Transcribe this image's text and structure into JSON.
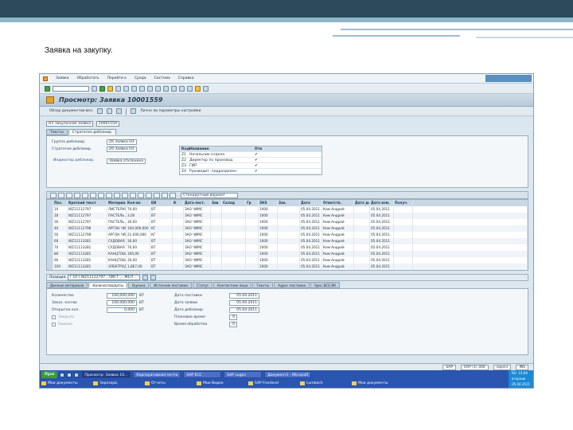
{
  "slide": {
    "title": "Заявка на закупку."
  },
  "menu": [
    "Заявка",
    "Обработать",
    "Перейти к",
    "Среда",
    "Система",
    "Справка"
  ],
  "window": {
    "title": "Просмотр: Заявка 10001559"
  },
  "app_toolbar": [
    "Обзор документов вкл.",
    "Лично ли параметры настройки"
  ],
  "doc_type": {
    "value": "НЗ Закупочная заявка",
    "doc_number": "10001559"
  },
  "header_tabs": [
    "Тексты",
    "Стратегия деблокир."
  ],
  "header": {
    "group_label": "Группа деблокир.",
    "group_value": "Z6 Заявка НЗ",
    "strategy_label": "Стратегия деблокир.",
    "strategy_value": "Z6 Заявка НЗ",
    "indicator_label": "Индикатор деблокир.",
    "indicator_value": "Заявка отклонена",
    "status_columns": [
      "Код",
      "Название",
      "Отк"
    ],
    "status_rows": [
      {
        "code": "Z1",
        "name": "Начальник отдела"
      },
      {
        "code": "Z2",
        "name": "Директор по производ."
      },
      {
        "code": "Z3",
        "name": "ГИП"
      },
      {
        "code": "Z4",
        "name": "Руководит. подразделен."
      }
    ]
  },
  "item_toolbar": {
    "select_label": "Стандартный вариант"
  },
  "grid": {
    "columns": [
      "",
      "Поз.",
      "Краткий текст",
      "Материал",
      "Кол-во",
      "ЕИ",
      "К",
      "Дата пост.",
      "Зав",
      "Склад",
      "Гр",
      "ЗНЗ",
      "Зак.",
      "Дата",
      "Ответств.",
      "Дата дебл.",
      "Дата изм.",
      "Получ.",
      ""
    ],
    "rows": [
      {
        "pos": "10",
        "text": "WZ11112797",
        "mat": "ЛИСТЕЛКОВОЛЬ_РОЗОВЫЙ",
        "qty": "70,00",
        "unit": "ВТ",
        "date1": "ЗАО ЧИМС",
        "werk": "1000",
        "lager": "05.04.2011",
        "ekgrp": "Ким Андрей",
        "due": "05.04.2011"
      },
      {
        "pos": "20",
        "text": "WZ11112797",
        "mat": "ПАСТЕЛЬ ДЛЯ ДЛ. УГЛОВАЯ",
        "qty": "3,00",
        "unit": "ВТ",
        "date1": "ЗАО ЧИМС",
        "werk": "1000",
        "lager": "05.04.2011",
        "ekgrp": "Ким Андрей",
        "due": "05.04.2011"
      },
      {
        "pos": "30",
        "text": "WZ11112797",
        "mat": "ПАСТЕЛЬ ДЛЯ ДЛ. УГЛОВАЯ",
        "qty": "30,00",
        "unit": "ВТ",
        "date1": "ЗАО ЧИМС",
        "werk": "1000",
        "lager": "05.04.2011",
        "ekgrp": "Ким Андрей",
        "due": "05.04.2011"
      },
      {
        "pos": "40",
        "text": "WZ11112798",
        "mat": "АРГОН ЧИСТЫЙ",
        "qty": "100,000,000",
        "unit": "КГ",
        "date1": "ЗАО ЧИМС",
        "werk": "1000",
        "lager": "05.04.2011",
        "ekgrp": "Ким Андрей",
        "due": "05.04.2011"
      },
      {
        "pos": "50",
        "text": "WZ11112798",
        "mat": "АРГОН ЧИСТЫЙ",
        "qty": "21,000,000",
        "unit": "КГ",
        "date1": "ЗАО ЧИМС",
        "werk": "1000",
        "lager": "05.04.2011",
        "ekgrp": "Ким Андрей",
        "due": "05.04.2011"
      },
      {
        "pos": "60",
        "text": "WZ11113281",
        "mat": "СУДОВАЯ ПЕНА ДЛЯ ЛЕЧ.",
        "qty": "30,00",
        "unit": "ВТ",
        "date1": "ЗАО ЧИМС",
        "werk": "1000",
        "lager": "05.04.2011",
        "ekgrp": "Ким Андрей",
        "due": "05.04.2011"
      },
      {
        "pos": "70",
        "text": "WZ11113281",
        "mat": "СУДОВАЯ ПЕНА ДЛЯ ЛЕЧ.",
        "qty": "70,00",
        "unit": "ВТ",
        "date1": "ЗАО ЧИМС",
        "werk": "1000",
        "lager": "05.04.2011",
        "ekgrp": "Ким Андрей",
        "due": "05.04.2011"
      },
      {
        "pos": "80",
        "text": "WZ11113281",
        "mat": "КАНЦТОВАРЫ ОФИСНЫЕ",
        "qty": "160,00",
        "unit": "ВТ",
        "date1": "ЗАО ЧИМС",
        "werk": "1000",
        "lager": "05.04.2011",
        "ekgrp": "Ким Андрей",
        "due": "05.04.2011"
      },
      {
        "pos": "90",
        "text": "WZ11113281",
        "mat": "КАНЦТОВАРЫ ОФИСНЫЕ",
        "qty": "30,00",
        "unit": "ВТ",
        "date1": "ЗАО ЧИМС",
        "werk": "1000",
        "lager": "05.04.2011",
        "ekgrp": "Ким Андрей",
        "due": "05.04.2011"
      },
      {
        "pos": "100",
        "text": "WZ11113281",
        "mat": "ЭЛЕКТРОД СВАРОЧНЫЙ СОРТ",
        "qty": "1,867,00",
        "unit": "ВТ",
        "date1": "ЗАО ЧИМС",
        "werk": "1000",
        "lager": "05.04.2011",
        "ekgrp": "Ким Андрей",
        "due": "05.04.2011"
      }
    ]
  },
  "item_detail": {
    "label": "Позиция",
    "value": "[ 10 ] WZ11112797 , ЛИСТ ... ЖЕЛ ..."
  },
  "item_tabs": [
    "Данные материала",
    "Количества/даты",
    "Оценка",
    "Источник поставки",
    "Статус",
    "Контактное лицо",
    "Тексты",
    "Адрес поставки",
    "Spec.BCE.BR"
  ],
  "detail": {
    "qty_req_label": "Количество",
    "qty_req": "100,000,000",
    "qty_req_unit": "ВТ",
    "qty_ordered_label": "Заказ. кол-во",
    "qty_ordered": "100,000,000",
    "qty_ordered_unit": "ВТ",
    "qty_open_label": "Открытое кол.",
    "qty_open": "0,000",
    "qty_open_unit": "ВТ",
    "flag1": "Закрыто",
    "flag2": "Оценка",
    "date_delivery_label": "Дата поставки",
    "date_delivery": "05.04.2011",
    "date_request_label": "Дата заявки",
    "date_request": "05.04.2011",
    "date_release_label": "Дата деблокир.",
    "date_release": "05.04.2011",
    "delivery_time_label": "Плановое время",
    "delivery_time": "0",
    "processing_label": "Время обработки",
    "processing": "0"
  },
  "statusbar": {
    "system": "SAP",
    "session": "ERP (1) 300",
    "server": "sapsrv",
    "mode": "INS"
  },
  "taskbar": {
    "start": "Пуск",
    "tasks": [
      "Просмотр: Заявка 10...",
      "Корпоративная почта",
      "SAP ECC",
      "SAP Logon",
      "Документ1 - Microsoft"
    ],
    "folders": [
      "Мои документы",
      "Зарезерв.",
      "Отчеты",
      "Мои Видео",
      "SAP Frontend",
      "Lumbach",
      "Мои документы"
    ],
    "tray": "RU  15:09\nвторник\n05.04.2011"
  }
}
